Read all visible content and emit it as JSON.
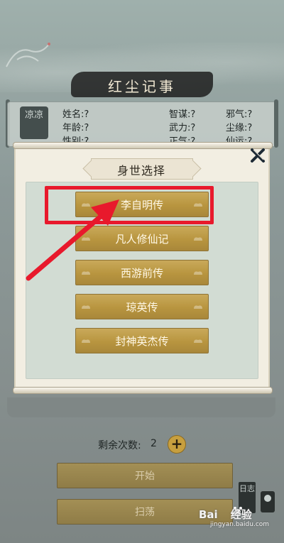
{
  "header": {
    "title": "红尘记事",
    "seal_text": "凉凉",
    "fields": [
      {
        "label": "姓名:",
        "value": "?"
      },
      {
        "label": "智谋:",
        "value": "?"
      },
      {
        "label": "邪气:",
        "value": "?"
      },
      {
        "label": "年龄:",
        "value": "?"
      },
      {
        "label": "武力:",
        "value": "?"
      },
      {
        "label": "尘缘:",
        "value": "?"
      },
      {
        "label": "性别:",
        "value": "?"
      },
      {
        "label": "正气:",
        "value": "?"
      },
      {
        "label": "仙运:",
        "value": "?"
      }
    ]
  },
  "dialog": {
    "title": "身世选择",
    "close_icon": "close-x-icon",
    "options": [
      "李自明传",
      "凡人修仙记",
      "西游前传",
      "琼英传",
      "封神英杰传"
    ],
    "selected_index": 0
  },
  "controls": {
    "remain_label": "剩余次数:",
    "remain_count": "2",
    "plus_label": "+",
    "start_label": "开始",
    "sweep_label": "扫荡",
    "diary_label": "日志"
  },
  "watermark": {
    "brand": "Bai",
    "brand_suffix": "经验",
    "url": "jingyan.baidu.com"
  },
  "colors": {
    "highlight": "#e8192c",
    "gold_button": "#b8953f",
    "panel_green": "#d2dcd3"
  }
}
